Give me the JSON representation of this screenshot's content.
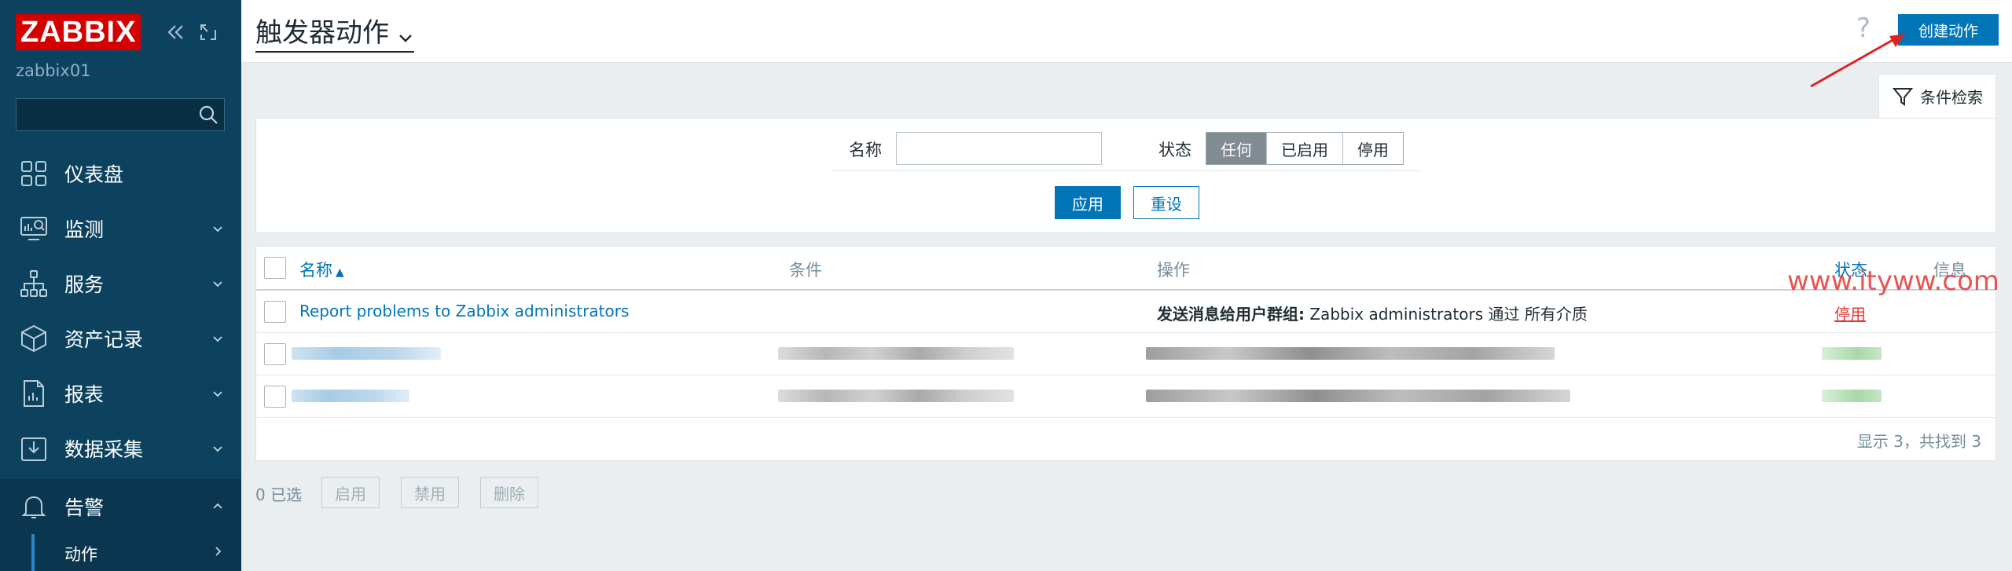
{
  "app": {
    "logo_text": "ZABBIX",
    "server_name": "zabbix01"
  },
  "sidebar": {
    "search_placeholder": "",
    "items": [
      {
        "label": "仪表盘",
        "icon": "dashboard-icon"
      },
      {
        "label": "监测",
        "icon": "monitoring-icon"
      },
      {
        "label": "服务",
        "icon": "services-icon"
      },
      {
        "label": "资产记录",
        "icon": "inventory-icon"
      },
      {
        "label": "报表",
        "icon": "reports-icon"
      },
      {
        "label": "数据采集",
        "icon": "data-collection-icon"
      },
      {
        "label": "告警",
        "icon": "alerts-icon"
      }
    ],
    "sub_item": {
      "label": "动作"
    }
  },
  "header": {
    "title": "触发器动作",
    "help": "?",
    "create_label": "创建动作"
  },
  "filter": {
    "tab_label": "条件检索",
    "name_label": "名称",
    "name_value": "",
    "status_label": "状态",
    "status_options": [
      "任何",
      "已启用",
      "停用"
    ],
    "status_selected": "任何",
    "apply_label": "应用",
    "reset_label": "重设"
  },
  "table": {
    "columns": {
      "name": "名称",
      "conditions": "条件",
      "operations": "操作",
      "status": "状态",
      "info": "信息"
    },
    "sort_indicator": "▲",
    "rows": [
      {
        "name": "Report problems to Zabbix administrators",
        "conditions": "",
        "operation_bold": "发送消息给用户群组:",
        "operation_rest": " Zabbix administrators 通过 所有介质",
        "status": "停用"
      }
    ],
    "footer": "显示 3，共找到 3"
  },
  "bulk": {
    "selected": "0 已选",
    "enable_label": "启用",
    "disable_label": "禁用",
    "delete_label": "删除"
  },
  "watermark": "www.ityww.com",
  "colors": {
    "sidebar_bg": "#0d425f",
    "brand_red": "#d40000",
    "primary_blue": "#0275b8",
    "status_disabled": "#e33734"
  }
}
